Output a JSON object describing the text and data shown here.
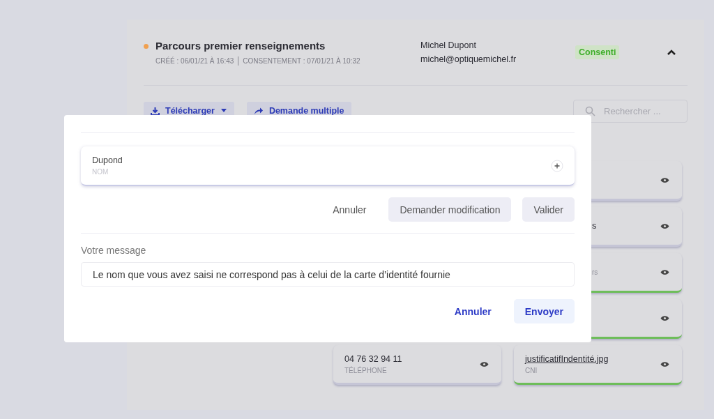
{
  "journey": {
    "title": "Parcours premier renseignements",
    "created": "CRÉÉ : 06/01/21 À 16:43",
    "consent": "CONSENTEMENT : 07/01/21 À 10:32",
    "contact_name": "Michel Dupont",
    "contact_email": "michel@optiquemichel.fr",
    "status": "Consenti",
    "expanded": true
  },
  "toolbar": {
    "download": "Télécharger",
    "multiple": "Demande multiple",
    "search_placeholder": "Rechercher ..."
  },
  "cards": [
    {
      "kind": "cut",
      "validated": false
    },
    {
      "kind": "cut",
      "value": "s",
      "validated": false
    },
    {
      "kind": "cut",
      "label": "rs",
      "validated": true
    },
    {
      "kind": "cut",
      "validated": true
    },
    {
      "kind": "full",
      "value": "04 76 32 94 11",
      "label": "TÉLÉPHONE",
      "validated": false,
      "link": false
    },
    {
      "kind": "full",
      "value": "justificatifIndentité.jpg",
      "label": "CNI",
      "validated": true,
      "link": true
    }
  ],
  "dialog": {
    "field_value": "Dupond",
    "field_label": "NOM",
    "cancel": "Annuler",
    "request": "Demander modification",
    "validate": "Valider",
    "message_label": "Votre message",
    "message": "Le nom que vous avez saisi ne correspond pas à celui de la carte d’identité fournie",
    "cancel_2": "Annuler",
    "send": "Envoyer"
  }
}
